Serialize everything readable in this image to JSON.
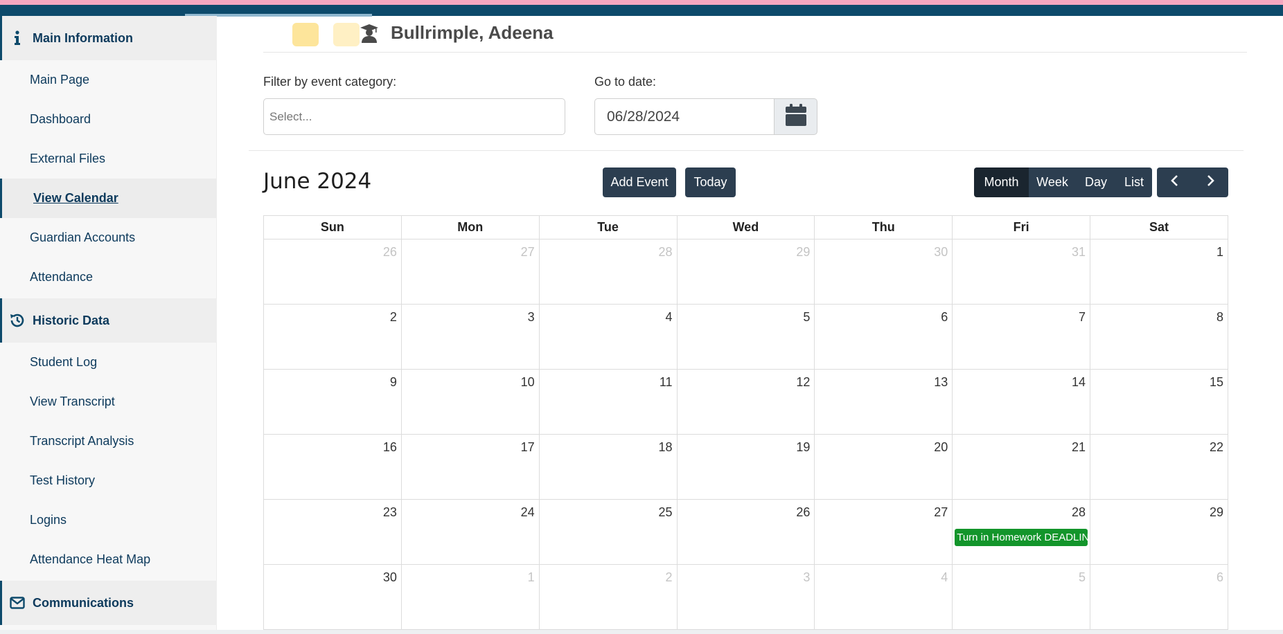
{
  "colors": {
    "accent": "#0d4a6b",
    "button": "#2c3e50",
    "event": "#13952b"
  },
  "sidebar": {
    "sections": [
      {
        "label": "Main Information",
        "icon": "info-icon"
      },
      {
        "label": "Historic Data",
        "icon": "history-icon"
      },
      {
        "label": "Communications",
        "icon": "envelope-icon"
      }
    ],
    "main_items": [
      "Main Page",
      "Dashboard",
      "External Files",
      "View Calendar",
      "Guardian Accounts",
      "Attendance"
    ],
    "historic_items": [
      "Student Log",
      "View Transcript",
      "Transcript Analysis",
      "Test History",
      "Logins",
      "Attendance Heat Map"
    ],
    "active_item": "View Calendar"
  },
  "header": {
    "student_name": "Bullrimple, Adeena",
    "icon": "graduate-icon"
  },
  "filters": {
    "category_label": "Filter by event category:",
    "category_placeholder": "Select...",
    "date_label": "Go to date:",
    "date_value": "06/28/2024",
    "date_button_icon": "calendar-icon"
  },
  "calendar": {
    "title": "June 2024",
    "add_event_label": "Add Event",
    "today_label": "Today",
    "views": [
      "Month",
      "Week",
      "Day",
      "List"
    ],
    "active_view": "Month",
    "prev_icon": "chevron-left-icon",
    "next_icon": "chevron-right-icon",
    "weekdays": [
      "Sun",
      "Mon",
      "Tue",
      "Wed",
      "Thu",
      "Fri",
      "Sat"
    ],
    "weeks": [
      [
        "26",
        "27",
        "28",
        "29",
        "30",
        "31",
        "1"
      ],
      [
        "2",
        "3",
        "4",
        "5",
        "6",
        "7",
        "8"
      ],
      [
        "9",
        "10",
        "11",
        "12",
        "13",
        "14",
        "15"
      ],
      [
        "16",
        "17",
        "18",
        "19",
        "20",
        "21",
        "22"
      ],
      [
        "23",
        "24",
        "25",
        "26",
        "27",
        "28",
        "29"
      ],
      [
        "30",
        "1",
        "2",
        "3",
        "4",
        "5",
        "6"
      ]
    ],
    "event": {
      "title": "Turn in Homework DEADLINE",
      "date": "28"
    }
  }
}
